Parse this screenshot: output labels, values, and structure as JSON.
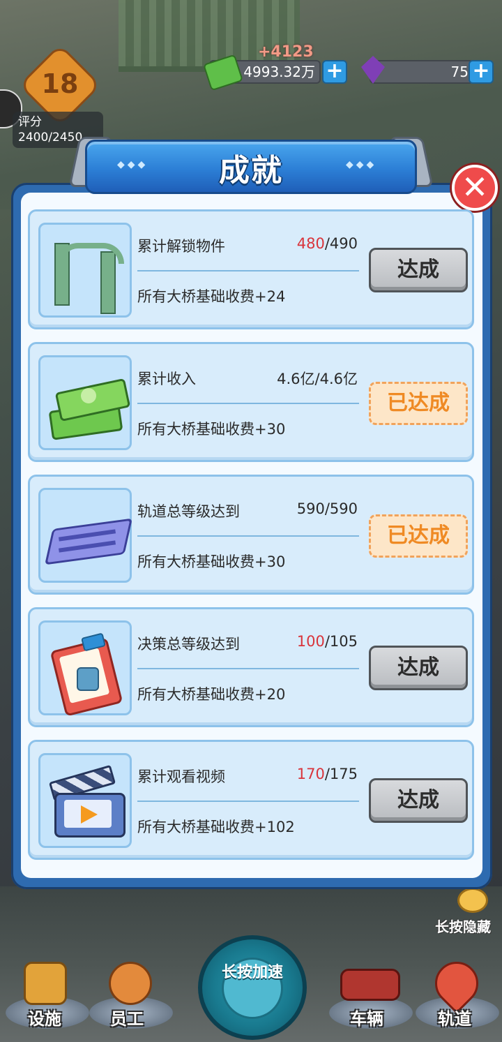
{
  "hud": {
    "income_delta": "+4123",
    "money": "4993.32万",
    "gems": "75",
    "plus_label": "+",
    "level": "18",
    "score_label": "评分",
    "score_value": "2400/2450"
  },
  "dialog": {
    "title": "成就",
    "title_dots": "◆◆◆",
    "close_label": "✕"
  },
  "achievements": [
    {
      "name": "累计解锁物件",
      "current": "480",
      "total": "/490",
      "reward": "所有大桥基础收费+24",
      "status": "达成",
      "claimable": true,
      "icon": "arch-gate-icon"
    },
    {
      "name": "累计收入",
      "current": "4.6亿",
      "total": "/4.6亿",
      "reward": "所有大桥基础收费+30",
      "status": "已达成",
      "claimable": false,
      "icon": "cash-stack-icon"
    },
    {
      "name": "轨道总等级达到",
      "current": "590",
      "total": "/590",
      "reward": "所有大桥基础收费+30",
      "status": "已达成",
      "claimable": false,
      "icon": "track-rail-icon"
    },
    {
      "name": "决策总等级达到",
      "current": "100",
      "total": "/105",
      "reward": "所有大桥基础收费+20",
      "status": "达成",
      "claimable": true,
      "icon": "clipboard-stamp-icon"
    },
    {
      "name": "累计观看视频",
      "current": "170",
      "total": "/175",
      "reward": "所有大桥基础收费+102",
      "status": "达成",
      "claimable": true,
      "icon": "video-clapper-icon"
    }
  ],
  "bottom_nav": {
    "facilities": "设施",
    "staff": "员工",
    "speed_up": "长按加速",
    "vehicles": "车辆",
    "tracks": "轨道",
    "hide_hint": "长按隐藏"
  },
  "colors": {
    "progress_incomplete": "#d9343b",
    "dialog_blue": "#2e6bb0",
    "done_orange": "#ef8a24"
  }
}
